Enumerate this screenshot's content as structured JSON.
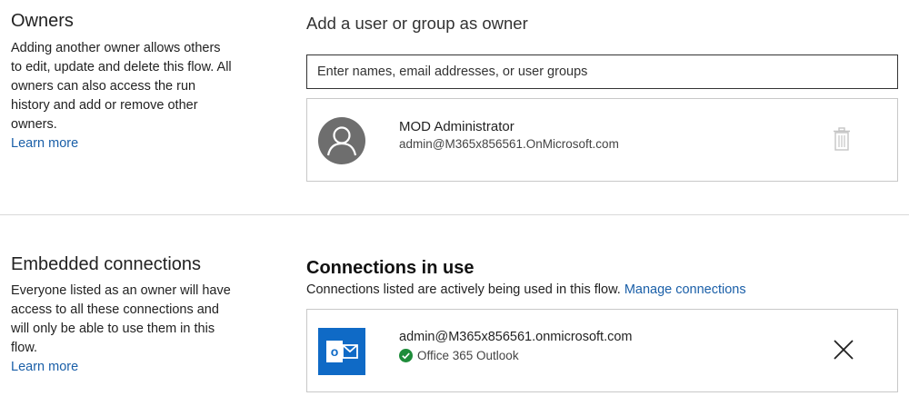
{
  "owners": {
    "title": "Owners",
    "description": "Adding another owner allows others to edit, update and delete this flow. All owners can also access the run history and add or remove other owners.",
    "learn_more": "Learn more"
  },
  "add_owner": {
    "title": "Add a user or group as owner",
    "placeholder": "Enter names, email addresses, or user groups",
    "value": ""
  },
  "owner_list": [
    {
      "name": "MOD Administrator",
      "email": "admin@M365x856561.OnMicrosoft.com",
      "avatar_icon": "person-icon",
      "action_icon": "trash-icon"
    }
  ],
  "embedded": {
    "title": "Embedded connections",
    "description": "Everyone listed as an owner will have access to all these connections and will only be able to use them in this flow.",
    "learn_more": "Learn more"
  },
  "connections": {
    "title": "Connections in use",
    "subtitle": "Connections listed are actively being used in this flow.",
    "manage_link": "Manage connections",
    "items": [
      {
        "email": "admin@M365x856561.onmicrosoft.com",
        "service": "Office 365 Outlook",
        "status_icon": "check-circle-icon",
        "app_icon": "outlook-icon",
        "action_icon": "close-icon"
      }
    ]
  },
  "colors": {
    "link": "#1a5fa8",
    "outlook_blue": "#0f6ac6",
    "check_green": "#1e8c3a",
    "avatar_gray": "#6e6e6e"
  }
}
